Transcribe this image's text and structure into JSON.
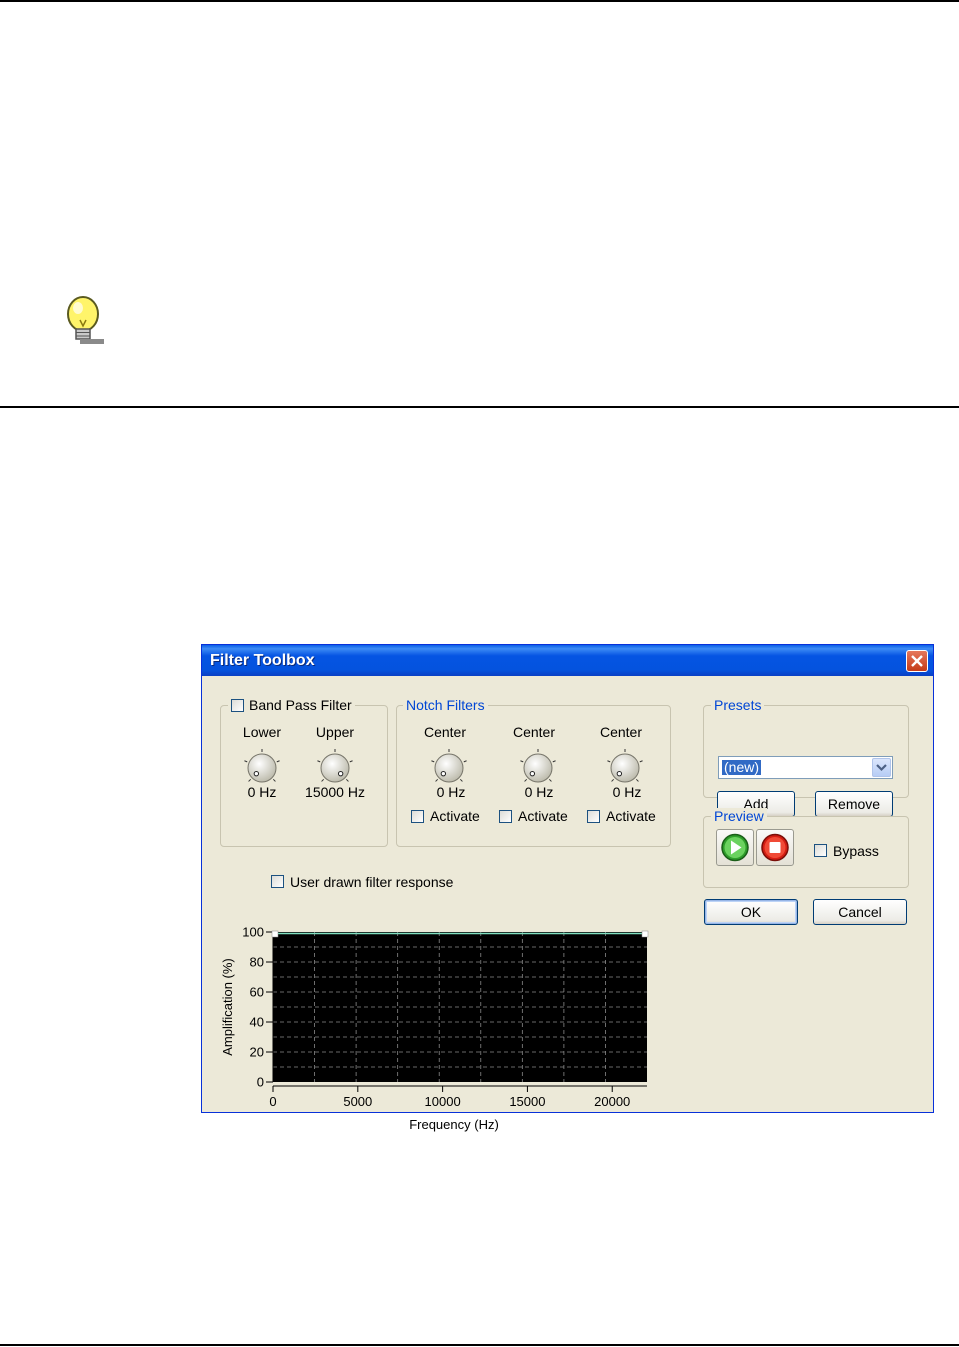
{
  "dialog": {
    "title": "Filter Toolbox",
    "band_pass": {
      "label": "Band Pass Filter",
      "checked": false,
      "lower": {
        "label": "Lower",
        "value": "0 Hz",
        "level": 0
      },
      "upper": {
        "label": "Upper",
        "value": "15000 Hz",
        "level": 1
      }
    },
    "notch": {
      "legend": "Notch Filters",
      "filters": [
        {
          "label": "Center",
          "value": "0 Hz",
          "activate": "Activate",
          "level": 0
        },
        {
          "label": "Center",
          "value": "0 Hz",
          "activate": "Activate",
          "level": 0
        },
        {
          "label": "Center",
          "value": "0 Hz",
          "activate": "Activate",
          "level": 0
        }
      ]
    },
    "user_drawn": {
      "label": "User drawn filter response",
      "checked": false
    },
    "presets": {
      "legend": "Presets",
      "selected": "(new)",
      "add_label": "Add",
      "remove_label": "Remove"
    },
    "preview": {
      "legend": "Preview",
      "bypass_label": "Bypass",
      "play_icon": "play-icon",
      "stop_icon": "stop-icon"
    },
    "ok_label": "OK",
    "cancel_label": "Cancel",
    "colors": {
      "title_bar": "#0554e3",
      "accent_legend": "#0046d5",
      "plot_bg": "#000000",
      "response_line": "#7fe0c0"
    }
  },
  "chart_data": {
    "type": "line",
    "xlabel": "Frequency (Hz)",
    "ylabel": "Amplification (%)",
    "xlim": [
      0,
      22050
    ],
    "ylim": [
      0,
      100
    ],
    "xticks": [
      "0",
      "5000",
      "10000",
      "15000",
      "20000"
    ],
    "yticks": [
      "100",
      "80",
      "60",
      "40",
      "20",
      "0"
    ],
    "grid": true,
    "series": [
      {
        "x": [
          0,
          22050
        ],
        "values": [
          100,
          100
        ]
      }
    ]
  }
}
